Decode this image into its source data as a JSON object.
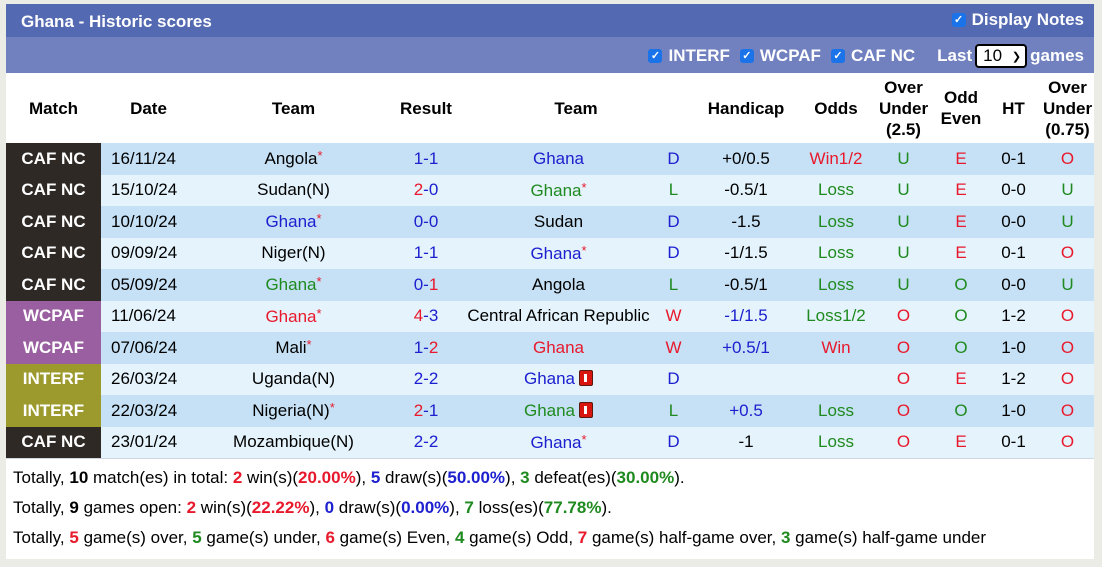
{
  "header": {
    "title": "Ghana - Historic scores",
    "display_notes_label": "Display Notes",
    "display_notes_checked": true
  },
  "filters": {
    "items": [
      {
        "label": "INTERF",
        "checked": true
      },
      {
        "label": "WCPAF",
        "checked": true
      },
      {
        "label": "CAF NC",
        "checked": true
      }
    ],
    "last_label": "Last",
    "last_value": "10",
    "games_label": "games"
  },
  "columns": {
    "match": "Match",
    "date": "Date",
    "home_team": "Team",
    "result": "Result",
    "away_team": "Team",
    "handicap": "Handicap",
    "odds": "Odds",
    "ou_line1": "Over",
    "ou_line2": "Under",
    "ou_line3": "(2.5)",
    "oe_line1": "Odd",
    "oe_line2": "Even",
    "ht": "HT",
    "ou2_line1": "Over",
    "ou2_line2": "Under",
    "ou2_line3": "(0.75)"
  },
  "colors": {
    "title_bar": "#5369b1",
    "filter_bar": "#7181bf",
    "caf_nc": "#2e2925",
    "wcpaf": "#9a5fa0",
    "interf": "#9c9a2d",
    "row_odd": "#c6e1f5",
    "row_even": "#e4f3fc",
    "red": "#e8192c",
    "blue": "#1d20cf",
    "green": "#1f8a1f"
  },
  "rows": [
    {
      "league": "CAF NC",
      "date": "16/11/24",
      "home": "Angola",
      "home_star": true,
      "home_color": "black",
      "home_score": "1",
      "home_score_color": "blue",
      "away_score": "1",
      "away_score_color": "blue",
      "away": "Ghana",
      "away_star": false,
      "away_color": "blue",
      "away_card": false,
      "wdl": "D",
      "wdl_color": "blue",
      "handicap": "+0/0.5",
      "handicap_color": "black",
      "odds": "Win1/2",
      "odds_color": "red",
      "ou": "U",
      "ou_color": "green",
      "oe": "E",
      "oe_color": "red",
      "ht": "0-1",
      "ou2": "O",
      "ou2_color": "red"
    },
    {
      "league": "CAF NC",
      "date": "15/10/24",
      "home": "Sudan(N)",
      "home_star": false,
      "home_color": "black",
      "home_score": "2",
      "home_score_color": "red",
      "away_score": "0",
      "away_score_color": "blue",
      "away": "Ghana",
      "away_star": true,
      "away_color": "green",
      "away_card": false,
      "wdl": "L",
      "wdl_color": "green",
      "handicap": "-0.5/1",
      "handicap_color": "black",
      "odds": "Loss",
      "odds_color": "green",
      "ou": "U",
      "ou_color": "green",
      "oe": "E",
      "oe_color": "red",
      "ht": "0-0",
      "ou2": "U",
      "ou2_color": "green"
    },
    {
      "league": "CAF NC",
      "date": "10/10/24",
      "home": "Ghana",
      "home_star": true,
      "home_color": "blue",
      "home_score": "0",
      "home_score_color": "blue",
      "away_score": "0",
      "away_score_color": "blue",
      "away": "Sudan",
      "away_star": false,
      "away_color": "black",
      "away_card": false,
      "wdl": "D",
      "wdl_color": "blue",
      "handicap": "-1.5",
      "handicap_color": "black",
      "odds": "Loss",
      "odds_color": "green",
      "ou": "U",
      "ou_color": "green",
      "oe": "E",
      "oe_color": "red",
      "ht": "0-0",
      "ou2": "U",
      "ou2_color": "green"
    },
    {
      "league": "CAF NC",
      "date": "09/09/24",
      "home": "Niger(N)",
      "home_star": false,
      "home_color": "black",
      "home_score": "1",
      "home_score_color": "blue",
      "away_score": "1",
      "away_score_color": "blue",
      "away": "Ghana",
      "away_star": true,
      "away_color": "blue",
      "away_card": false,
      "wdl": "D",
      "wdl_color": "blue",
      "handicap": "-1/1.5",
      "handicap_color": "black",
      "odds": "Loss",
      "odds_color": "green",
      "ou": "U",
      "ou_color": "green",
      "oe": "E",
      "oe_color": "red",
      "ht": "0-1",
      "ou2": "O",
      "ou2_color": "red"
    },
    {
      "league": "CAF NC",
      "date": "05/09/24",
      "home": "Ghana",
      "home_star": true,
      "home_color": "green",
      "home_score": "0",
      "home_score_color": "blue",
      "away_score": "1",
      "away_score_color": "red",
      "away": "Angola",
      "away_star": false,
      "away_color": "black",
      "away_card": false,
      "wdl": "L",
      "wdl_color": "green",
      "handicap": "-0.5/1",
      "handicap_color": "black",
      "odds": "Loss",
      "odds_color": "green",
      "ou": "U",
      "ou_color": "green",
      "oe": "O",
      "oe_color": "green",
      "ht": "0-0",
      "ou2": "U",
      "ou2_color": "green"
    },
    {
      "league": "WCPAF",
      "date": "11/06/24",
      "home": "Ghana",
      "home_star": true,
      "home_color": "red",
      "home_score": "4",
      "home_score_color": "red",
      "away_score": "3",
      "away_score_color": "blue",
      "away": "Central African Republic",
      "away_star": false,
      "away_color": "black",
      "away_card": false,
      "wdl": "W",
      "wdl_color": "red",
      "handicap": "-1/1.5",
      "handicap_color": "blue",
      "odds": "Loss1/2",
      "odds_color": "green",
      "ou": "O",
      "ou_color": "red",
      "oe": "O",
      "oe_color": "green",
      "ht": "1-2",
      "ou2": "O",
      "ou2_color": "red"
    },
    {
      "league": "WCPAF",
      "date": "07/06/24",
      "home": "Mali",
      "home_star": true,
      "home_color": "black",
      "home_score": "1",
      "home_score_color": "blue",
      "away_score": "2",
      "away_score_color": "red",
      "away": "Ghana",
      "away_star": false,
      "away_color": "red",
      "away_card": false,
      "wdl": "W",
      "wdl_color": "red",
      "handicap": "+0.5/1",
      "handicap_color": "blue",
      "odds": "Win",
      "odds_color": "red",
      "ou": "O",
      "ou_color": "red",
      "oe": "O",
      "oe_color": "green",
      "ht": "1-0",
      "ou2": "O",
      "ou2_color": "red"
    },
    {
      "league": "INTERF",
      "date": "26/03/24",
      "home": "Uganda(N)",
      "home_star": false,
      "home_color": "black",
      "home_score": "2",
      "home_score_color": "blue",
      "away_score": "2",
      "away_score_color": "blue",
      "away": "Ghana",
      "away_star": false,
      "away_color": "blue",
      "away_card": true,
      "wdl": "D",
      "wdl_color": "blue",
      "handicap": "",
      "handicap_color": "black",
      "odds": "",
      "odds_color": "green",
      "ou": "O",
      "ou_color": "red",
      "oe": "E",
      "oe_color": "red",
      "ht": "1-2",
      "ou2": "O",
      "ou2_color": "red"
    },
    {
      "league": "INTERF",
      "date": "22/03/24",
      "home": "Nigeria(N)",
      "home_star": true,
      "home_color": "black",
      "home_score": "2",
      "home_score_color": "red",
      "away_score": "1",
      "away_score_color": "blue",
      "away": "Ghana",
      "away_star": false,
      "away_color": "green",
      "away_card": true,
      "wdl": "L",
      "wdl_color": "green",
      "handicap": "+0.5",
      "handicap_color": "blue",
      "odds": "Loss",
      "odds_color": "green",
      "ou": "O",
      "ou_color": "red",
      "oe": "O",
      "oe_color": "green",
      "ht": "1-0",
      "ou2": "O",
      "ou2_color": "red"
    },
    {
      "league": "CAF NC",
      "date": "23/01/24",
      "home": "Mozambique(N)",
      "home_star": false,
      "home_color": "black",
      "home_score": "2",
      "home_score_color": "blue",
      "away_score": "2",
      "away_score_color": "blue",
      "away": "Ghana",
      "away_star": true,
      "away_color": "blue",
      "away_card": false,
      "wdl": "D",
      "wdl_color": "blue",
      "handicap": "-1",
      "handicap_color": "black",
      "odds": "Loss",
      "odds_color": "green",
      "ou": "O",
      "ou_color": "red",
      "oe": "E",
      "oe_color": "red",
      "ht": "0-1",
      "ou2": "O",
      "ou2_color": "red"
    }
  ],
  "summary": [
    [
      {
        "t": "Totally, ",
        "c": ""
      },
      {
        "t": "10",
        "c": "b"
      },
      {
        "t": " match(es) in total: ",
        "c": ""
      },
      {
        "t": "2",
        "c": "b red"
      },
      {
        "t": " win(s)(",
        "c": ""
      },
      {
        "t": "20.00%",
        "c": "b red"
      },
      {
        "t": "), ",
        "c": ""
      },
      {
        "t": "5",
        "c": "b blue"
      },
      {
        "t": " draw(s)(",
        "c": ""
      },
      {
        "t": "50.00%",
        "c": "b blue"
      },
      {
        "t": "), ",
        "c": ""
      },
      {
        "t": "3",
        "c": "b green"
      },
      {
        "t": " defeat(es)(",
        "c": ""
      },
      {
        "t": "30.00%",
        "c": "b green"
      },
      {
        "t": ").",
        "c": ""
      }
    ],
    [
      {
        "t": "Totally, ",
        "c": ""
      },
      {
        "t": "9",
        "c": "b"
      },
      {
        "t": " games open: ",
        "c": ""
      },
      {
        "t": "2",
        "c": "b red"
      },
      {
        "t": " win(s)(",
        "c": ""
      },
      {
        "t": "22.22%",
        "c": "b red"
      },
      {
        "t": "), ",
        "c": ""
      },
      {
        "t": "0",
        "c": "b blue"
      },
      {
        "t": " draw(s)(",
        "c": ""
      },
      {
        "t": "0.00%",
        "c": "b blue"
      },
      {
        "t": "), ",
        "c": ""
      },
      {
        "t": "7",
        "c": "b green"
      },
      {
        "t": " loss(es)(",
        "c": ""
      },
      {
        "t": "77.78%",
        "c": "b green"
      },
      {
        "t": ").",
        "c": ""
      }
    ],
    [
      {
        "t": "Totally, ",
        "c": ""
      },
      {
        "t": "5",
        "c": "b red"
      },
      {
        "t": " game(s) over, ",
        "c": ""
      },
      {
        "t": "5",
        "c": "b green"
      },
      {
        "t": " game(s) under, ",
        "c": ""
      },
      {
        "t": "6",
        "c": "b red"
      },
      {
        "t": " game(s) Even, ",
        "c": ""
      },
      {
        "t": "4",
        "c": "b green"
      },
      {
        "t": " game(s) Odd, ",
        "c": ""
      },
      {
        "t": "7",
        "c": "b red"
      },
      {
        "t": " game(s) half-game over, ",
        "c": ""
      },
      {
        "t": "3",
        "c": "b green"
      },
      {
        "t": " game(s) half-game under",
        "c": ""
      }
    ]
  ]
}
